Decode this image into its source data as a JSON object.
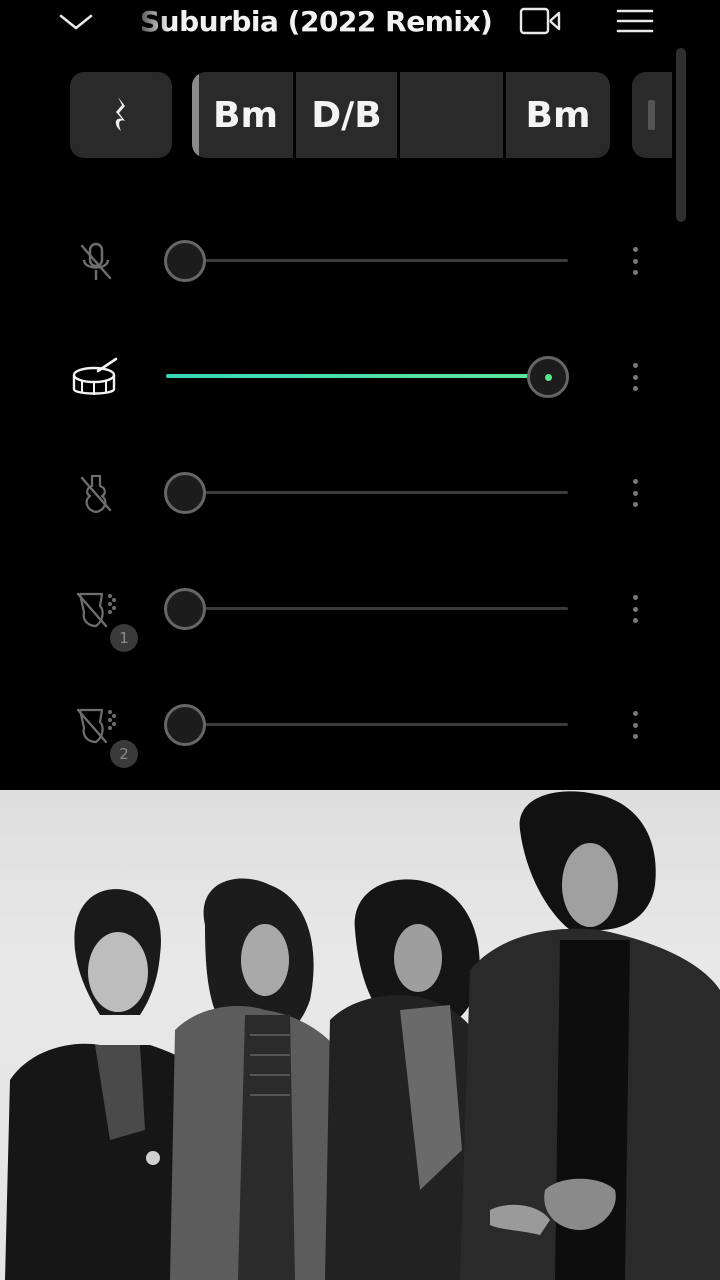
{
  "header": {
    "title": "Suburbia (2022 Remix)",
    "collapse_icon": "chevron-down-icon",
    "video_icon": "video-camera-icon",
    "menu_icon": "hamburger-menu-icon"
  },
  "chord_strip": {
    "rest_icon": "quarter-rest-icon",
    "chords": [
      "Bm",
      "D/B",
      "",
      "Bm"
    ]
  },
  "tracks": [
    {
      "id": "vocals",
      "icon": "microphone-muted-icon",
      "volume": 0,
      "active": false
    },
    {
      "id": "drums",
      "icon": "drum-icon",
      "volume": 1.0,
      "active": true
    },
    {
      "id": "bass",
      "icon": "bass-guitar-muted-icon",
      "volume": 0,
      "active": false
    },
    {
      "id": "guitar-1",
      "icon": "electric-guitar-muted-icon",
      "volume": 0,
      "active": false,
      "badge": "1"
    },
    {
      "id": "guitar-2",
      "icon": "electric-guitar-muted-icon",
      "volume": 0,
      "active": false,
      "badge": "2"
    }
  ],
  "video": {
    "description_icon": "band-photo-video-icon"
  },
  "colors": {
    "accent": "#55e88e",
    "accent_teal": "#38d6b8",
    "surface": "#2a2a2a",
    "background": "#000000"
  }
}
